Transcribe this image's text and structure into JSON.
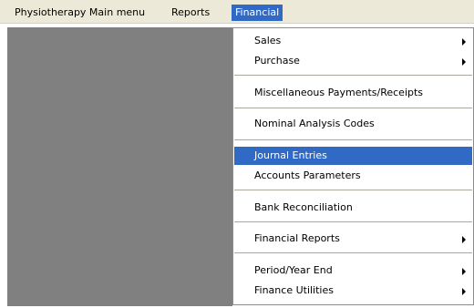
{
  "menubar": {
    "items": [
      {
        "label": "Physiotherapy Main menu"
      },
      {
        "label": "Reports"
      },
      {
        "label": "Financial"
      }
    ]
  },
  "dropdown": {
    "items": [
      {
        "label": "Sales",
        "submenu": true
      },
      {
        "label": "Purchase",
        "submenu": true
      },
      {
        "label": "Miscellaneous Payments/Receipts"
      },
      {
        "label": "Nominal Analysis Codes"
      },
      {
        "label": "Journal Entries",
        "highlighted": true
      },
      {
        "label": "Accounts Parameters"
      },
      {
        "label": "Bank Reconciliation"
      },
      {
        "label": "Financial Reports",
        "submenu": true
      },
      {
        "label": "Period/Year End",
        "submenu": true
      },
      {
        "label": "Finance Utilities",
        "submenu": true
      }
    ]
  },
  "colors": {
    "menubar_bg": "#ece9d8",
    "highlight": "#316ac5",
    "workspace": "#808080"
  },
  "icons": {
    "submenu": "submenu-arrow-icon"
  }
}
